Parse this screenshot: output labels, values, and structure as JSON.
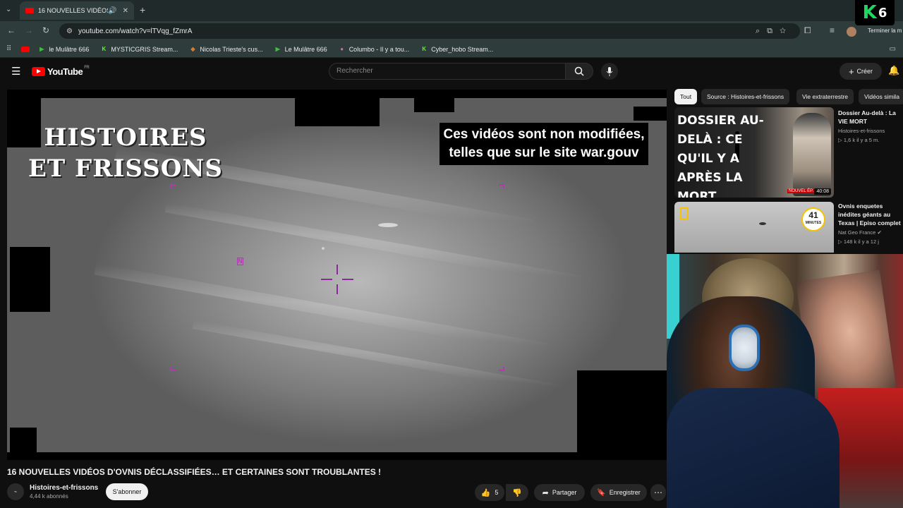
{
  "browser": {
    "tab_title": "16 NOUVELLES VIDÉOS D'O",
    "url": "youtube.com/watch?v=lTVqg_fZmrA",
    "bookmarks": [
      {
        "label": "le Mulâtre 666",
        "icon": "play-icon",
        "color": "#3fbf3f"
      },
      {
        "label": "MYSTICGRIS Stream...",
        "icon": "kick-icon",
        "color": "#53fc18"
      },
      {
        "label": "Nicolas Trieste's cus...",
        "icon": "fox-icon",
        "color": "#e07a2a"
      },
      {
        "label": "Le Mulâtre 666",
        "icon": "play-icon",
        "color": "#3fbf3f"
      },
      {
        "label": "Columbo - Il y a tou...",
        "icon": "columbo-icon",
        "color": "#d36aa8"
      },
      {
        "label": "Cyber_hobo Stream...",
        "icon": "kick-icon",
        "color": "#53fc18"
      }
    ],
    "finish_label": "Terminer la m"
  },
  "youtube": {
    "logo_text": "YouTube",
    "logo_region": "FR",
    "search_placeholder": "Rechercher",
    "create_label": "Créer"
  },
  "player": {
    "brand_line1": "HISTOIRES",
    "brand_line2": "ET FRISSONS",
    "notice": "Ces vidéos sont non modifiées, telles que sur le site  war.gouv",
    "north_marker": "N"
  },
  "video": {
    "title": "16 NOUVELLES VIDÉOS D'OVNIS DÉCLASSIFIÉES… ET CERTAINES SONT TROUBLANTES !",
    "channel": "Histoires-et-frissons",
    "subscribers": "4,44 k abonnés",
    "subscribe_label": "S'abonner",
    "likes": "5",
    "share_label": "Partager",
    "save_label": "Enregistrer"
  },
  "chips": [
    "Tout",
    "Source : Histoires-et-frissons",
    "Vie extraterrestre",
    "Vidéos simila"
  ],
  "recommendations": [
    {
      "thumb_text": "DOSSIER AU-DELÀ : CE QU'IL Y A APRÈS LA MORT",
      "badge": "NOUVEL ÉP.",
      "duration": "40:08",
      "title": "Dossier Au-delà : La VIE MORT",
      "channel": "Histoires-et-frissons",
      "meta": "▷ 1,6 k  il y a 5 m."
    },
    {
      "minutes_num": "41",
      "minutes_label": "MINUTES",
      "title": "Ovnis enquetes inédites géants au Texas | Episo complet",
      "channel": "Nat Geo France",
      "meta": "▷ 148 k  il y a 12 j"
    }
  ],
  "overlay": {
    "k6_letter": "K",
    "k6_number": "6"
  }
}
